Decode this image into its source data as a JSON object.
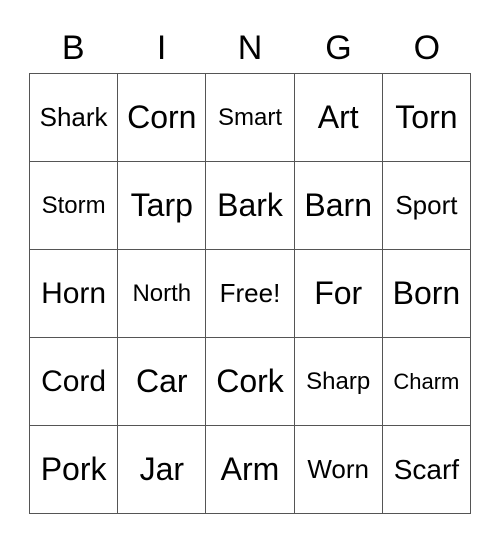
{
  "header": [
    "B",
    "I",
    "N",
    "G",
    "O"
  ],
  "cells": [
    [
      "Shark",
      "Corn",
      "Smart",
      "Art",
      "Torn"
    ],
    [
      "Storm",
      "Tarp",
      "Bark",
      "Barn",
      "Sport"
    ],
    [
      "Horn",
      "North",
      "Free!",
      "For",
      "Born"
    ],
    [
      "Cord",
      "Car",
      "Cork",
      "Sharp",
      "Charm"
    ],
    [
      "Pork",
      "Jar",
      "Arm",
      "Worn",
      "Scarf"
    ]
  ]
}
